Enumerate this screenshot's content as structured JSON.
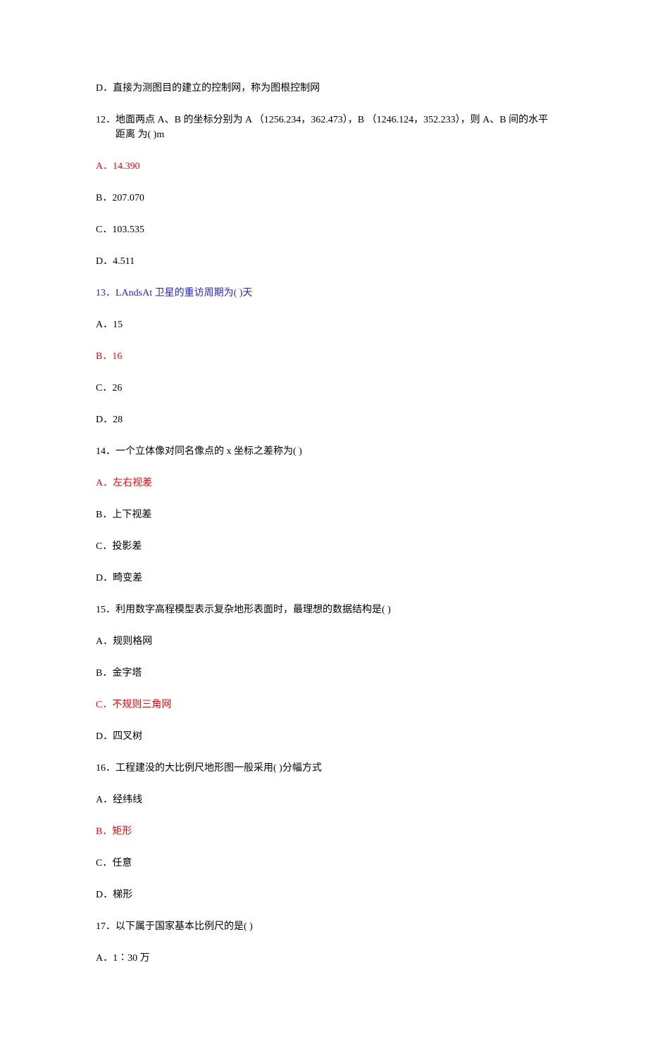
{
  "items": [
    {
      "text": "D．直接为测图目的建立的控制网，称为图根控制网",
      "cls": ""
    },
    {
      "text": "12．地面两点 A、B 的坐标分别为 A （1256.234，362.473），B （1246.124，352.233），则 A、B 间的水平距离 为(   )m",
      "cls": "question question-indent"
    },
    {
      "text": "A．14.390",
      "cls": "red"
    },
    {
      "text": "B．207.070",
      "cls": ""
    },
    {
      "text": "C．103.535",
      "cls": ""
    },
    {
      "text": "D．4.511",
      "cls": ""
    },
    {
      "text": "13．LAndsAt 卫星的重访周期为(   )天",
      "cls": "blue"
    },
    {
      "text": "A．15",
      "cls": ""
    },
    {
      "text": "B．16",
      "cls": "red"
    },
    {
      "text": "C．26",
      "cls": ""
    },
    {
      "text": "D．28",
      "cls": ""
    },
    {
      "text": "14．一个立体像对同名像点的 x 坐标之差称为(   )",
      "cls": ""
    },
    {
      "text": "A．左右视差",
      "cls": "red"
    },
    {
      "text": "B．上下视差",
      "cls": ""
    },
    {
      "text": "C．投影差",
      "cls": ""
    },
    {
      "text": "D．畸变差",
      "cls": ""
    },
    {
      "text": "15．利用数字高程模型表示复杂地形表面时，最理想的数据结构是(   )",
      "cls": ""
    },
    {
      "text": "A．规则格网",
      "cls": ""
    },
    {
      "text": "B．金字塔",
      "cls": ""
    },
    {
      "text": "C．不规则三角网",
      "cls": "red"
    },
    {
      "text": "D．四叉树",
      "cls": ""
    },
    {
      "text": "16．工程建没的大比例尺地形图一般采用(   )分幅方式",
      "cls": ""
    },
    {
      "text": "A．经纬线",
      "cls": ""
    },
    {
      "text": "B．矩形",
      "cls": "red"
    },
    {
      "text": "C．任意",
      "cls": ""
    },
    {
      "text": "D．梯形",
      "cls": ""
    },
    {
      "text": "17．以下属于国家基本比例尺的是(   )",
      "cls": ""
    },
    {
      "text": "A．1∶30 万",
      "cls": ""
    }
  ]
}
